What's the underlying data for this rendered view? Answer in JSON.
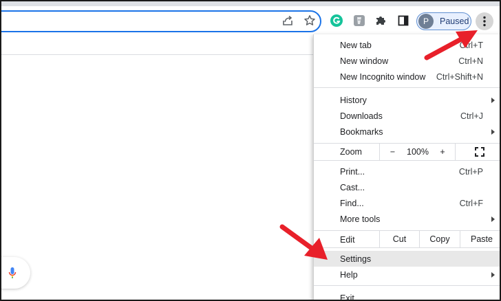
{
  "toolbar": {
    "profile_initial": "P",
    "profile_status": "Paused",
    "icons": [
      "share-icon",
      "star-icon",
      "grammarly-icon",
      "extension-icon",
      "puzzle-icon",
      "side-panel-icon",
      "more-vert-icon"
    ]
  },
  "menu": {
    "new_tab": {
      "label": "New tab",
      "shortcut": "Ctrl+T"
    },
    "new_window": {
      "label": "New window",
      "shortcut": "Ctrl+N"
    },
    "new_incognito": {
      "label": "New Incognito window",
      "shortcut": "Ctrl+Shift+N"
    },
    "history": {
      "label": "History"
    },
    "downloads": {
      "label": "Downloads",
      "shortcut": "Ctrl+J"
    },
    "bookmarks": {
      "label": "Bookmarks"
    },
    "zoom": {
      "label": "Zoom",
      "minus": "−",
      "value": "100%",
      "plus": "+"
    },
    "print": {
      "label": "Print...",
      "shortcut": "Ctrl+P"
    },
    "cast": {
      "label": "Cast..."
    },
    "find": {
      "label": "Find...",
      "shortcut": "Ctrl+F"
    },
    "more_tools": {
      "label": "More tools"
    },
    "edit": {
      "label": "Edit",
      "cut": "Cut",
      "copy": "Copy",
      "paste": "Paste"
    },
    "settings": {
      "label": "Settings"
    },
    "help": {
      "label": "Help"
    },
    "exit": {
      "label": "Exit"
    }
  },
  "colors": {
    "omnibox_focus": "#1a73e8",
    "profile_chip_bg": "#e8f0fe",
    "annotation_arrow": "#e8202a",
    "hover_row": "#e8e8e8"
  }
}
